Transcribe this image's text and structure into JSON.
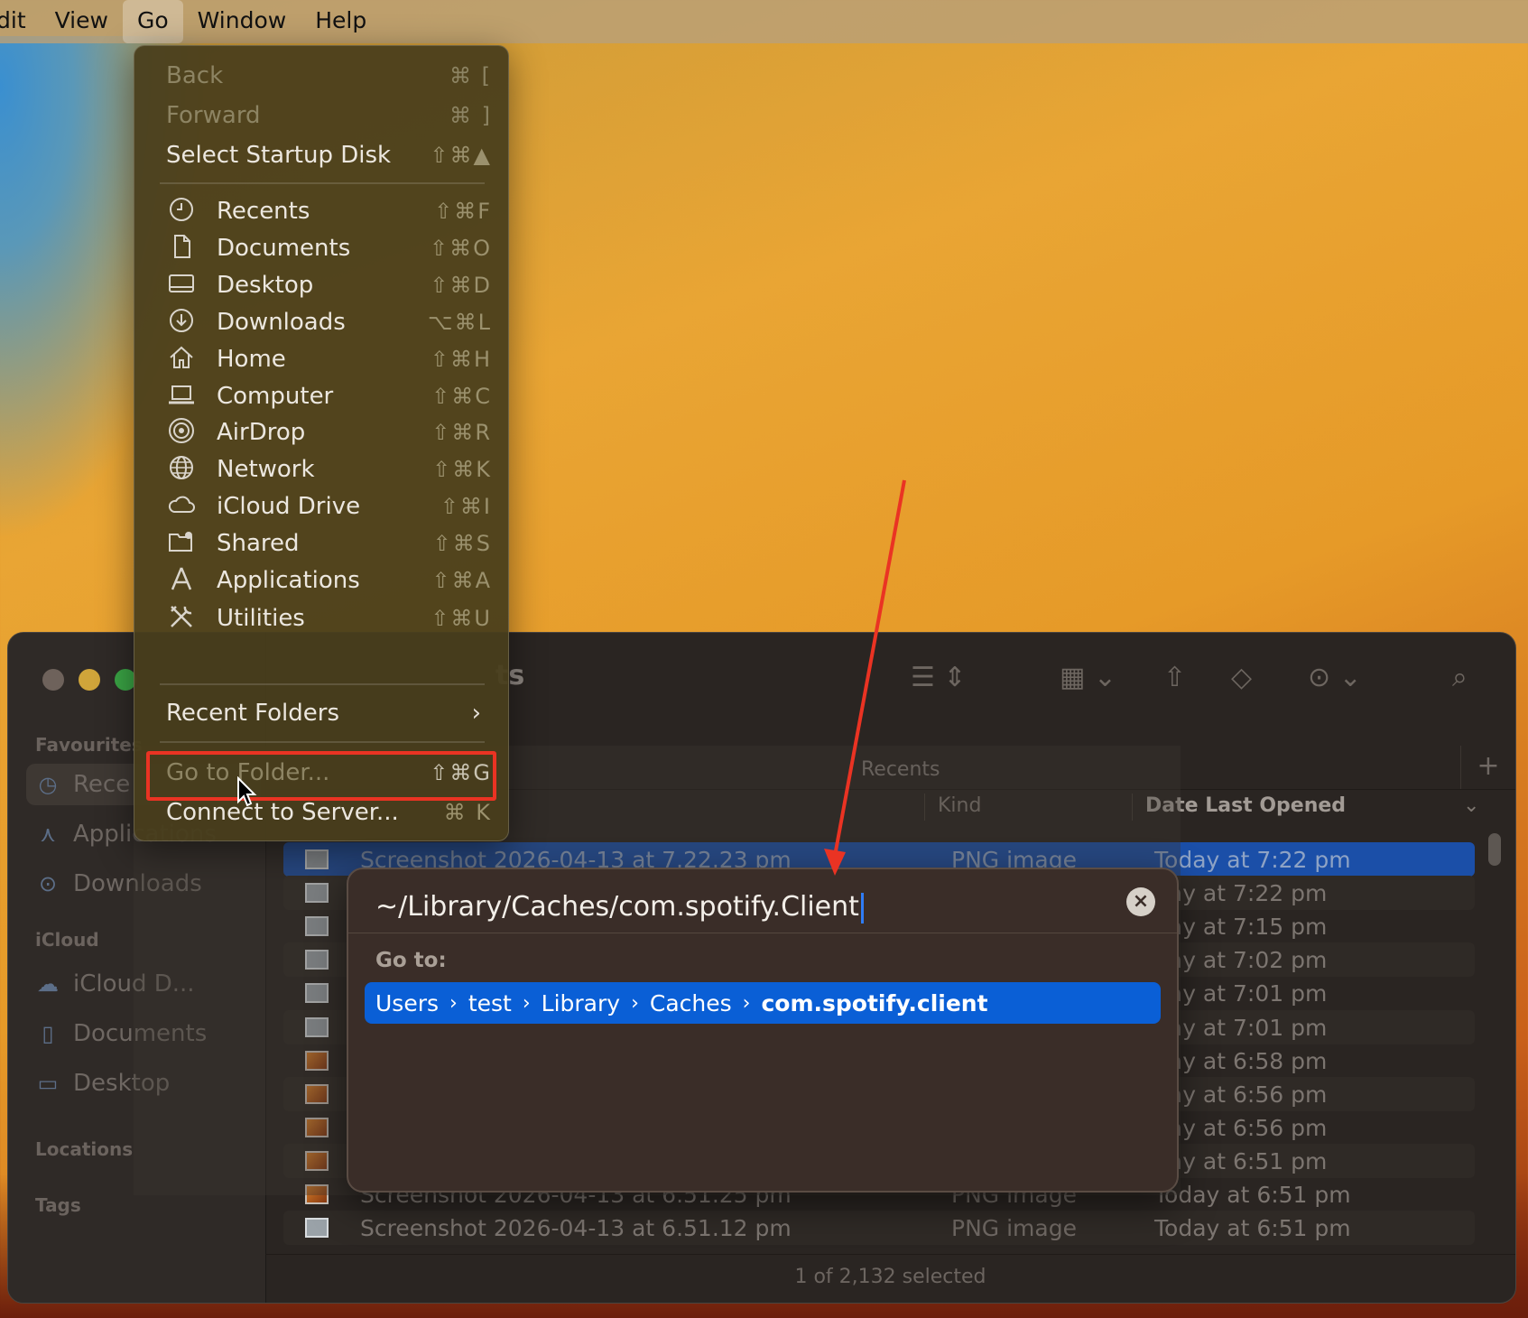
{
  "menubar": {
    "items": [
      {
        "label": "dit"
      },
      {
        "label": "View"
      },
      {
        "label": "Go"
      },
      {
        "label": "Window"
      },
      {
        "label": "Help"
      }
    ]
  },
  "go_menu": {
    "items": [
      {
        "label": "Back",
        "shortcut": "⌘ [",
        "enabled": false
      },
      {
        "label": "Forward",
        "shortcut": "⌘ ]",
        "enabled": false
      },
      {
        "label": "Select Startup Disk",
        "shortcut": "⇧⌘▲",
        "enabled": true
      },
      {
        "label": "Recents",
        "shortcut": "⇧⌘F",
        "icon": "clock-icon"
      },
      {
        "label": "Documents",
        "shortcut": "⇧⌘O",
        "icon": "document-icon"
      },
      {
        "label": "Desktop",
        "shortcut": "⇧⌘D",
        "icon": "desktop-icon"
      },
      {
        "label": "Downloads",
        "shortcut": "⌥⌘L",
        "icon": "download-icon"
      },
      {
        "label": "Home",
        "shortcut": "⇧⌘H",
        "icon": "home-icon"
      },
      {
        "label": "Computer",
        "shortcut": "⇧⌘C",
        "icon": "laptop-icon"
      },
      {
        "label": "AirDrop",
        "shortcut": "⇧⌘R",
        "icon": "airdrop-icon"
      },
      {
        "label": "Network",
        "shortcut": "⇧⌘K",
        "icon": "globe-icon"
      },
      {
        "label": "iCloud Drive",
        "shortcut": "⇧⌘I",
        "icon": "cloud-icon"
      },
      {
        "label": "Shared",
        "shortcut": "⇧⌘S",
        "icon": "shared-folder-icon"
      },
      {
        "label": "Applications",
        "shortcut": "⇧⌘A",
        "icon": "applications-icon"
      },
      {
        "label": "Utilities",
        "shortcut": "⇧⌘U",
        "icon": "utilities-icon"
      },
      {
        "label": "Recent Folders",
        "submenu": true
      },
      {
        "label": "Go to Folder...",
        "shortcut": "⇧⌘G",
        "enabled": false
      },
      {
        "label": "Connect to Server...",
        "shortcut": "⌘ K",
        "enabled": true
      }
    ]
  },
  "finder": {
    "title": "ts",
    "sidebar": {
      "favourites_heading": "Favourites",
      "favourites": [
        {
          "label": "Rece",
          "icon": "clock-icon"
        },
        {
          "label": "Applications",
          "icon": "applications-icon"
        },
        {
          "label": "Downloads",
          "icon": "download-icon"
        }
      ],
      "icloud_heading": "iCloud",
      "icloud": [
        {
          "label": "iCloud D...",
          "icon": "cloud-icon"
        },
        {
          "label": "Documents",
          "icon": "document-icon"
        },
        {
          "label": "Desktop",
          "icon": "desktop-icon"
        }
      ],
      "locations_heading": "Locations",
      "tags_heading": "Tags"
    },
    "tab_label": "Recents",
    "columns": {
      "kind": "Kind",
      "date": "Date Last Opened"
    },
    "rows": [
      {
        "name": "Screenshot 2026-04-13 at 7.22.23 pm",
        "kind": "PNG image",
        "date": "Today at 7:22 pm"
      },
      {
        "name": "",
        "kind": "",
        "date": "day at 7:22 pm"
      },
      {
        "name": "",
        "kind": "",
        "date": "day at 7:15 pm"
      },
      {
        "name": "",
        "kind": "",
        "date": "day at 7:02 pm"
      },
      {
        "name": "",
        "kind": "",
        "date": "day at 7:01 pm"
      },
      {
        "name": "",
        "kind": "",
        "date": "day at 7:01 pm"
      },
      {
        "name": "",
        "kind": "",
        "date": "day at 6:58 pm"
      },
      {
        "name": "",
        "kind": "",
        "date": "day at 6:56 pm"
      },
      {
        "name": "",
        "kind": "",
        "date": "day at 6:56 pm"
      },
      {
        "name": "",
        "kind": "",
        "date": "day at 6:51 pm"
      },
      {
        "name": "Screenshot 2026-04-13 at 6.51.25 pm",
        "kind": "PNG image",
        "date": "Today at 6:51 pm"
      },
      {
        "name": "Screenshot 2026-04-13 at 6.51.12 pm",
        "kind": "PNG image",
        "date": "Today at 6:51 pm"
      }
    ],
    "status": "1 of 2,132 selected"
  },
  "goto_sheet": {
    "path_value": "~/Library/Caches/com.spotify.Client",
    "goto_label": "Go to:",
    "suggestion": [
      "Users",
      "test",
      "Library",
      "Caches",
      "com.spotify.client"
    ]
  },
  "colors": {
    "annotation_red": "#ea3323",
    "selection_blue": "#0a5fd6"
  }
}
